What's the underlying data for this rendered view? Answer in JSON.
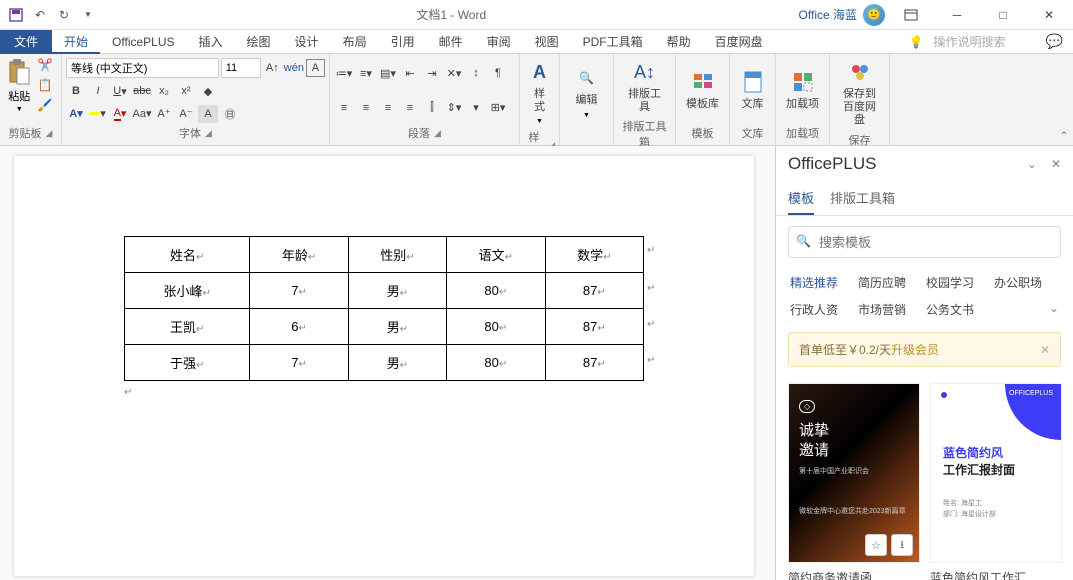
{
  "titlebar": {
    "title": "文档1 - Word",
    "user": "Office 海蓝"
  },
  "tabs": {
    "file": "文件",
    "items": [
      "开始",
      "OfficePLUS",
      "插入",
      "绘图",
      "设计",
      "布局",
      "引用",
      "邮件",
      "审阅",
      "视图",
      "PDF工具箱",
      "帮助",
      "百度网盘"
    ],
    "search_hint": "操作说明搜索"
  },
  "ribbon": {
    "clip": {
      "paste": "粘贴",
      "label": "剪贴板"
    },
    "font": {
      "name": "等线 (中文正文)",
      "size": "11",
      "label": "字体"
    },
    "para": {
      "label": "段落"
    },
    "styles": {
      "btn": "样式",
      "label": "样式"
    },
    "edit": {
      "btn": "编辑"
    },
    "layout": {
      "btn": "排版工具",
      "label": "排版工具箱"
    },
    "template": {
      "btn": "模板库",
      "label": "模板"
    },
    "wenku": {
      "btn": "文库",
      "label": "文库"
    },
    "addin": {
      "btn": "加载项",
      "label": "加载项"
    },
    "save": {
      "btn": "保存到百度网盘",
      "label": "保存"
    }
  },
  "table": {
    "headers": [
      "姓名",
      "年龄",
      "性别",
      "语文",
      "数学"
    ],
    "rows": [
      [
        "张小峰",
        "7",
        "男",
        "80",
        "87"
      ],
      [
        "王凯",
        "6",
        "男",
        "80",
        "87"
      ],
      [
        "于强",
        "7",
        "男",
        "80",
        "87"
      ]
    ]
  },
  "side": {
    "title": "OfficePLUS",
    "tabs": [
      "模板",
      "排版工具箱"
    ],
    "search_placeholder": "搜索模板",
    "cats": [
      "精选推荐",
      "简历应聘",
      "校园学习",
      "办公职场",
      "行政人资",
      "市场营销",
      "公务文书"
    ],
    "banner_prefix": "首单低至￥0.2/天",
    "banner_link": "升级会员",
    "templates": [
      {
        "title": "简约商务邀请函",
        "line1": "诚挚",
        "line2": "邀请",
        "sub1": "第十届中国产业职识会",
        "sub2": "微软金牌中心邀您共赴2023新篇章"
      },
      {
        "title": "蓝色简约风工作汇...",
        "t1": "蓝色简约风",
        "t2": "工作汇报封面",
        "brand": "OFFICEPLUS",
        "m1": "姓名: 海星工",
        "m2": "部门: 海星设计部"
      }
    ]
  }
}
